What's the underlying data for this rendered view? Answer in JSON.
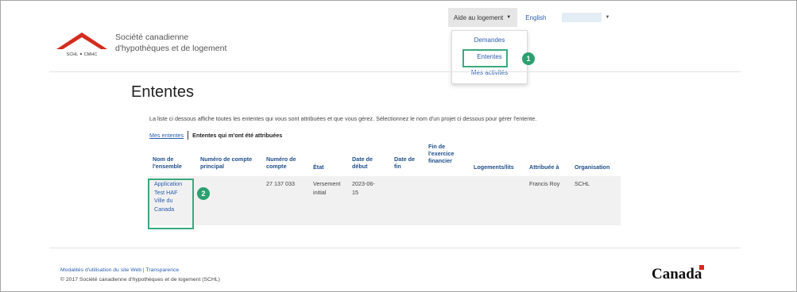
{
  "nav": {
    "aide_label": "Aide au logement",
    "lang_label": "English"
  },
  "dropdown": {
    "items": [
      {
        "label": "Demandes"
      },
      {
        "label": "Ententes"
      },
      {
        "label": "Mes activités"
      }
    ]
  },
  "callouts": [
    "1",
    "2"
  ],
  "brand": {
    "logo_text": "SCHL ✦ CMHC",
    "name_line1": "Société canadienne",
    "name_line2": "d'hypothèques et de logement"
  },
  "page": {
    "title": "Ententes",
    "intro": "La liste ci dessous affiche toutes les ententes qui vous sont attribuées et que vous gérez. Sélectionnez le nom d'un projet ci dessous pour gérer l'entente.",
    "tabs": [
      {
        "label": "Mes ententes"
      },
      {
        "label": "Ententes qui m'ont été attribuées"
      }
    ]
  },
  "table": {
    "headers": [
      "Nom de l'ensemble",
      "Numéro de compte principal",
      "Numéro de compte",
      "État",
      "Date de début",
      "Date de fin",
      "Fin de l'exercice financier",
      "Logements/lits",
      "Attribuée à",
      "Organisation"
    ],
    "rows": [
      {
        "nom_line1": "Application",
        "nom_line2": "Test HAF",
        "nom_line3": "Ville du",
        "nom_line4": "Canada",
        "compte_principal": "",
        "compte": "27 137 033",
        "etat_line1": "Versement",
        "etat_line2": "initial",
        "debut_line1": "2023-06-",
        "debut_line2": "15",
        "fin": "",
        "fin_exercice": "",
        "logements": "",
        "attribuee": "Francis Roy",
        "organisation": "SCHL"
      }
    ]
  },
  "footer": {
    "links": "Modalités d'utilisation du site Web | Transparence",
    "copyright": "© 2017 Société canadienne d'hypothèques et de logement (SCHL)",
    "wordmark": "Canada"
  },
  "colors": {
    "link": "#2a5db0",
    "highlight": "#3aaa7e",
    "brand_red": "#d52b1e"
  }
}
